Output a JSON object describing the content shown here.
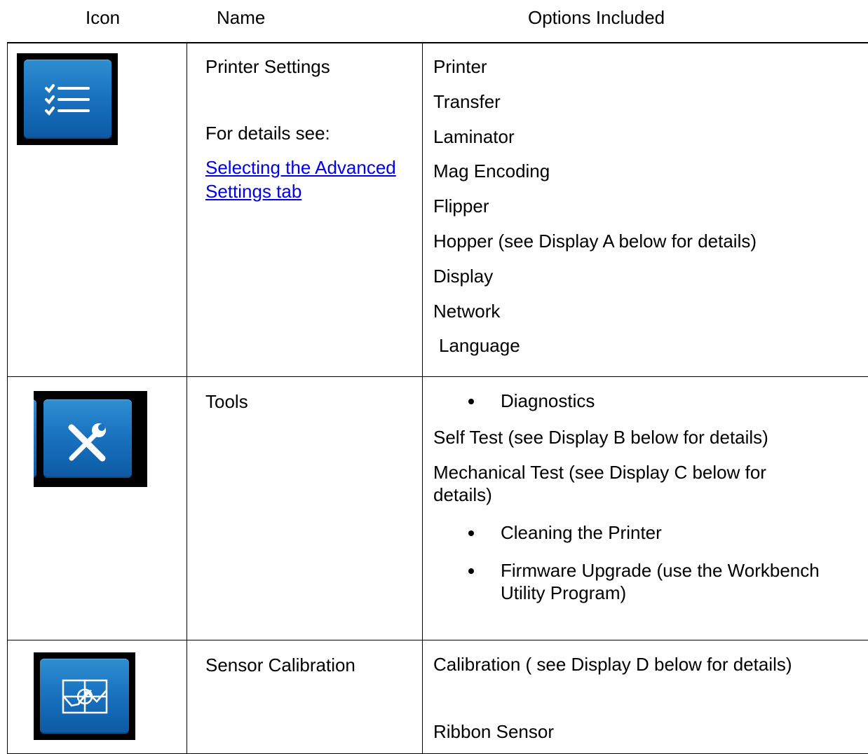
{
  "headers": {
    "icon": "Icon",
    "name": "Name",
    "options": "Options Included"
  },
  "rows": [
    {
      "icon": "checklist-icon",
      "name": "Printer Settings",
      "details_label": "For details see:",
      "link_text": "Selecting the Advanced Settings tab",
      "options": [
        "Printer",
        "Transfer",
        "Laminator",
        "Mag Encoding",
        "Flipper",
        "Hopper (see Display A below for details)",
        "Display",
        "Network",
        "Language"
      ]
    },
    {
      "icon": "tools-icon",
      "name": "Tools",
      "options": [
        "Diagnostics",
        "Self Test (see  Display B below for details)",
        "Mechanical Test  (see Display C below for details)",
        "Cleaning the Printer",
        "Firmware Upgrade (use the Workbench Utility Program)"
      ]
    },
    {
      "icon": "sensor-calibration-icon",
      "name": "Sensor Calibration",
      "options": [
        "Calibration  ( see Display D below for details)",
        "Ribbon Sensor"
      ]
    }
  ],
  "colors": {
    "icon_blue": "#1a73c0",
    "link": "#0000ee",
    "icon_bg": "#000000"
  }
}
